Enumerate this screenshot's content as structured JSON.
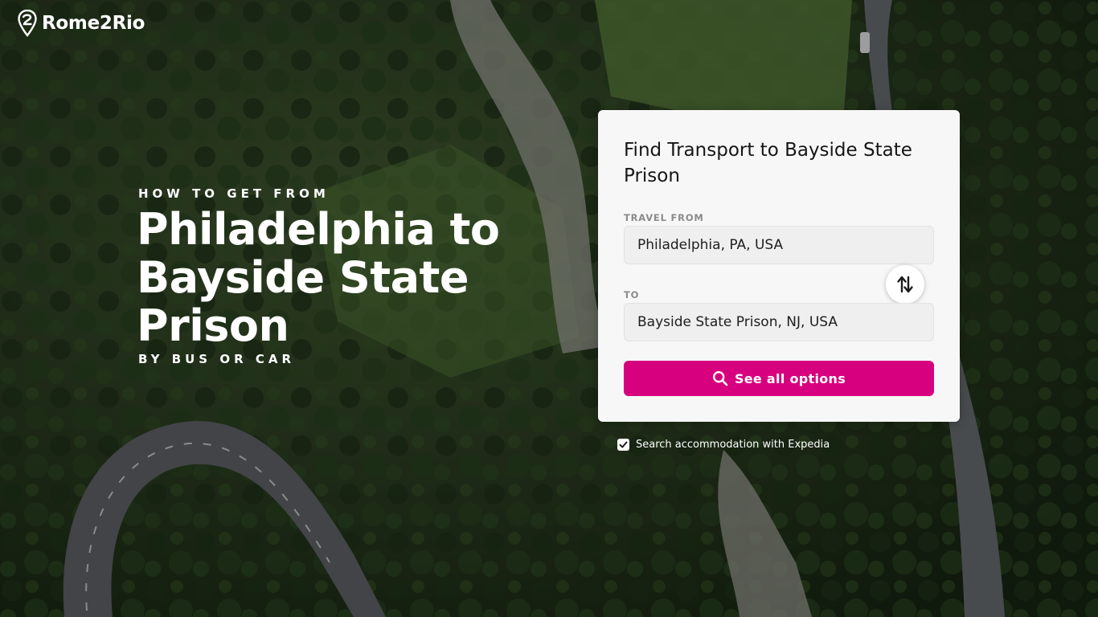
{
  "brand": {
    "name": "Rome2Rio"
  },
  "hero": {
    "kicker": "HOW TO GET FROM",
    "headline_line1": "Philadelphia to",
    "headline_line2": "Bayside State Prison",
    "subline": "BY BUS OR CAR"
  },
  "search_card": {
    "title": "Find Transport to Bayside State Prison",
    "from_label": "TRAVEL FROM",
    "from_value": "Philadelphia, PA, USA",
    "to_label": "TO",
    "to_value": "Bayside State Prison, NJ, USA",
    "swap_icon": "swap-arrows-icon",
    "submit_label": "See all options",
    "submit_icon": "search-icon"
  },
  "accommodation": {
    "label": "Search accommodation with Expedia",
    "checked": true
  },
  "colors": {
    "accent": "#d7007e",
    "card_bg": "#f7f7f7",
    "field_bg": "#efefef"
  }
}
